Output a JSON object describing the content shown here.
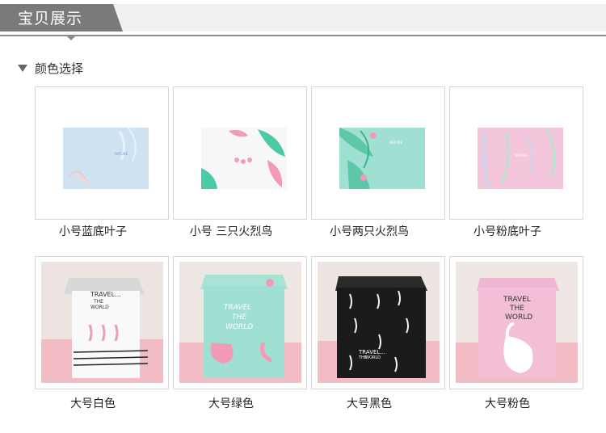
{
  "header": {
    "title": "宝贝展示"
  },
  "section": {
    "title": "颜色选择"
  },
  "colors": {
    "tab": "#7a7a7a",
    "band": "#f0f0f0",
    "blue": "#cfe2f2",
    "mint": "#9fe0d2",
    "pink": "#f3bfd7",
    "flamingo": "#f19bb6",
    "leaf": "#4cc9a6",
    "black": "#1b1b1b"
  },
  "small_items": [
    {
      "label": "小号蓝底叶子"
    },
    {
      "label": "小号 三只火烈鸟"
    },
    {
      "label": "小号两只火烈鸟"
    },
    {
      "label": "小号粉底叶子"
    }
  ],
  "large_items": [
    {
      "label": "大号白色",
      "print": "TRAVEL...",
      "print2": "THE",
      "print3": "WORLD"
    },
    {
      "label": "大号绿色",
      "print": "TRAVEL",
      "print2": "THE",
      "print3": "WORLD"
    },
    {
      "label": "大号黑色",
      "print": "TRAVEL...",
      "print2": "THE",
      "print3": "WORLD"
    },
    {
      "label": "大号粉色",
      "print": "TRAVEL",
      "print2": "THE",
      "print3": "WORLD"
    }
  ]
}
